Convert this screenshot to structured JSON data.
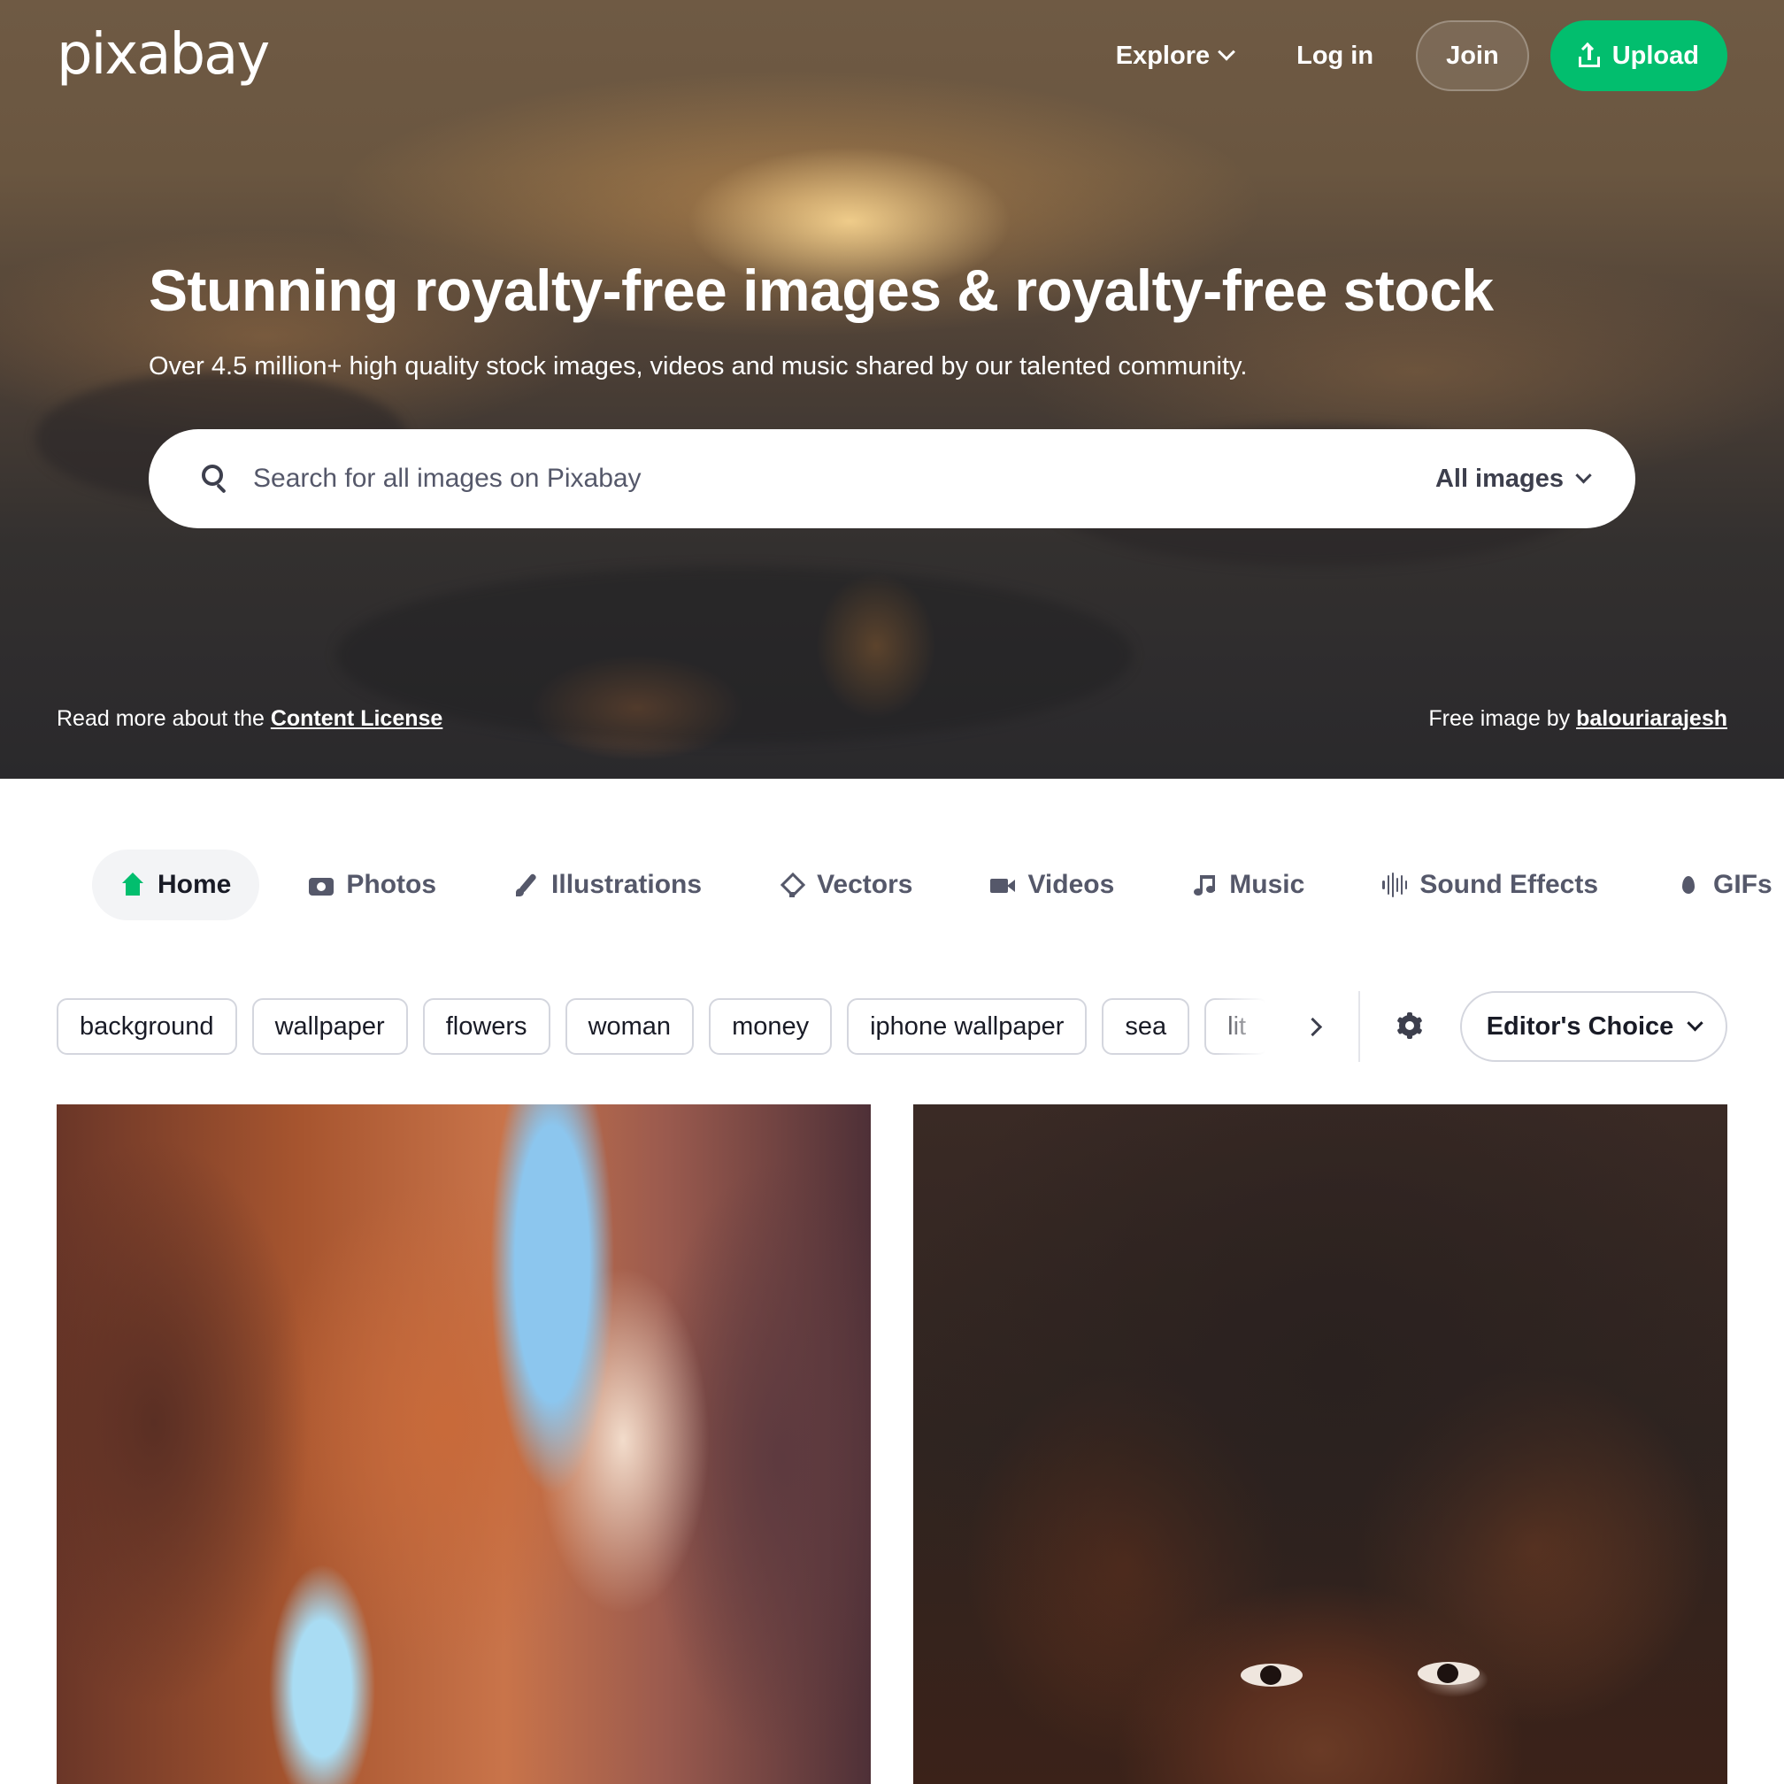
{
  "header": {
    "logo_text": "pixabay",
    "explore_label": "Explore",
    "login_label": "Log in",
    "join_label": "Join",
    "upload_label": "Upload"
  },
  "hero": {
    "title": "Stunning royalty-free images & royalty-free stock",
    "subtitle": "Over 4.5 million+ high quality stock images, videos and music shared by our talented community.",
    "license_prefix": "Read more about the ",
    "license_link": "Content License",
    "credit_prefix": "Free image by ",
    "credit_author": "balouriarajesh"
  },
  "search": {
    "placeholder": "Search for all images on Pixabay",
    "value": "",
    "scope_label": "All images"
  },
  "tabs": [
    {
      "label": "Home",
      "icon": "home-icon",
      "active": true
    },
    {
      "label": "Photos",
      "icon": "camera-icon",
      "active": false
    },
    {
      "label": "Illustrations",
      "icon": "brush-icon",
      "active": false
    },
    {
      "label": "Vectors",
      "icon": "pen-tool-icon",
      "active": false
    },
    {
      "label": "Videos",
      "icon": "video-camera-icon",
      "active": false
    },
    {
      "label": "Music",
      "icon": "music-note-icon",
      "active": false
    },
    {
      "label": "Sound Effects",
      "icon": "sound-wave-icon",
      "active": false
    },
    {
      "label": "GIFs",
      "icon": "flame-icon",
      "active": false
    }
  ],
  "tags": [
    "background",
    "wallpaper",
    "flowers",
    "woman",
    "money",
    "iphone wallpaper",
    "sea",
    "lit"
  ],
  "sort": {
    "label": "Editor's Choice"
  },
  "colors": {
    "accent": "#02be6e",
    "text_primary": "#191b26",
    "text_secondary": "#55586a",
    "border": "#d4d6de"
  }
}
